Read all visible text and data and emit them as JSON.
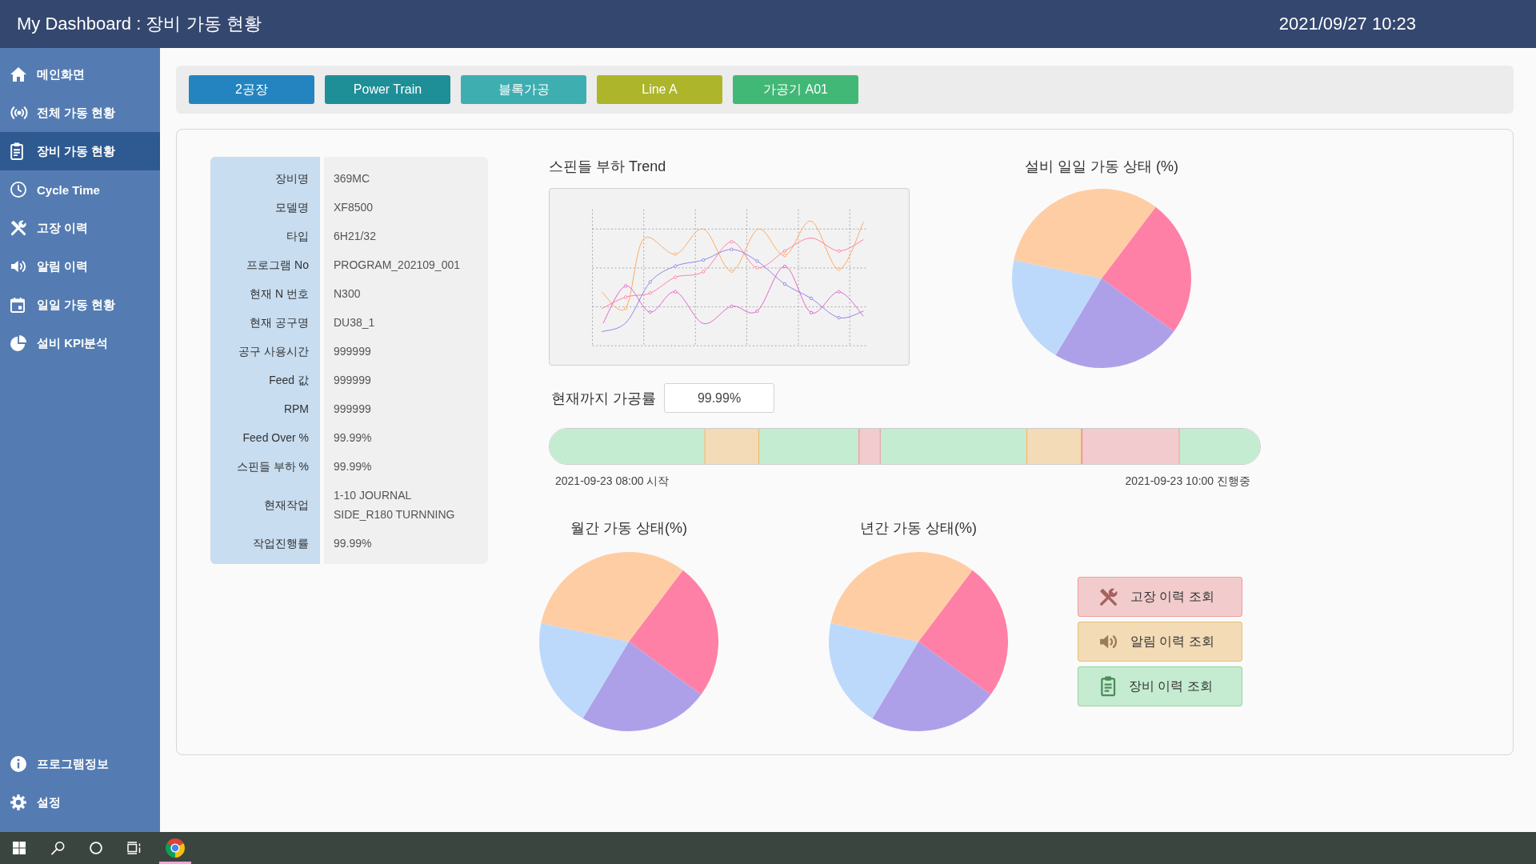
{
  "header": {
    "title": "My Dashboard : 장비 가동 현황",
    "datetime": "2021/09/27 10:23"
  },
  "sidebar": {
    "items": [
      {
        "label": "메인화면",
        "selected": false
      },
      {
        "label": "전체 가동 현황",
        "selected": false
      },
      {
        "label": "장비 가동 현황",
        "selected": true
      },
      {
        "label": "Cycle Time",
        "selected": false
      },
      {
        "label": "고장 이력",
        "selected": false
      },
      {
        "label": "알림 이력",
        "selected": false
      },
      {
        "label": "일일 가동 현황",
        "selected": false
      },
      {
        "label": "설비 KPI분석",
        "selected": false
      }
    ],
    "footer_items": [
      {
        "label": "프로그램정보",
        "selected": false
      },
      {
        "label": "설정",
        "selected": false
      }
    ]
  },
  "breadcrumb": [
    {
      "label": "2공장",
      "color": "#2484c0"
    },
    {
      "label": "Power Train",
      "color": "#1e8e97"
    },
    {
      "label": "블록가공",
      "color": "#3eaeb0"
    },
    {
      "label": "Line A",
      "color": "#adb52a"
    },
    {
      "label": "가공기 A01",
      "color": "#41b875"
    }
  ],
  "equipment_info": [
    {
      "label": "장비명",
      "value": "369MC"
    },
    {
      "label": "모델명",
      "value": "XF8500"
    },
    {
      "label": "타입",
      "value": "6H21/32"
    },
    {
      "label": "프로그램 No",
      "value": "PROGRAM_202109_001"
    },
    {
      "label": "현재 N 번호",
      "value": "N300"
    },
    {
      "label": "현재 공구명",
      "value": "DU38_1"
    },
    {
      "label": "공구 사용시간",
      "value": "999999"
    },
    {
      "label": "Feed 값",
      "value": "999999"
    },
    {
      "label": "RPM",
      "value": "999999"
    },
    {
      "label": "Feed Over %",
      "value": "99.99%"
    },
    {
      "label": "스핀들 부하 %",
      "value": "99.99%"
    },
    {
      "label": "현재작업",
      "value": "1-10 JOURNAL SIDE_R180 TURNNING"
    },
    {
      "label": "작업진행률",
      "value": "99.99%"
    }
  ],
  "trend": {
    "title": "스핀들 부하 Trend"
  },
  "daily_status": {
    "title": "설비 일일 가동 상태 (%)"
  },
  "progress": {
    "label": "현재까지 가공률",
    "value": "99.99%"
  },
  "timeline": {
    "start_label": "2021-09-23 08:00 시작",
    "end_label": "2021-09-23 10:00 진행중"
  },
  "monthly_status": {
    "title": "월간 가동 상태(%)"
  },
  "yearly_status": {
    "title": "년간 가동 상태(%)"
  },
  "history_buttons": [
    {
      "label": "고장 이력 조회",
      "kind": "fault"
    },
    {
      "label": "알림 이력 조회",
      "kind": "alarm"
    },
    {
      "label": "장비 이력 조회",
      "kind": "equipment"
    }
  ],
  "taskbar": [
    {
      "kind": "start",
      "active": false
    },
    {
      "kind": "search",
      "active": false
    },
    {
      "kind": "assistant",
      "active": false
    },
    {
      "kind": "taskview",
      "active": false
    },
    {
      "kind": "browser",
      "active": true
    }
  ]
}
